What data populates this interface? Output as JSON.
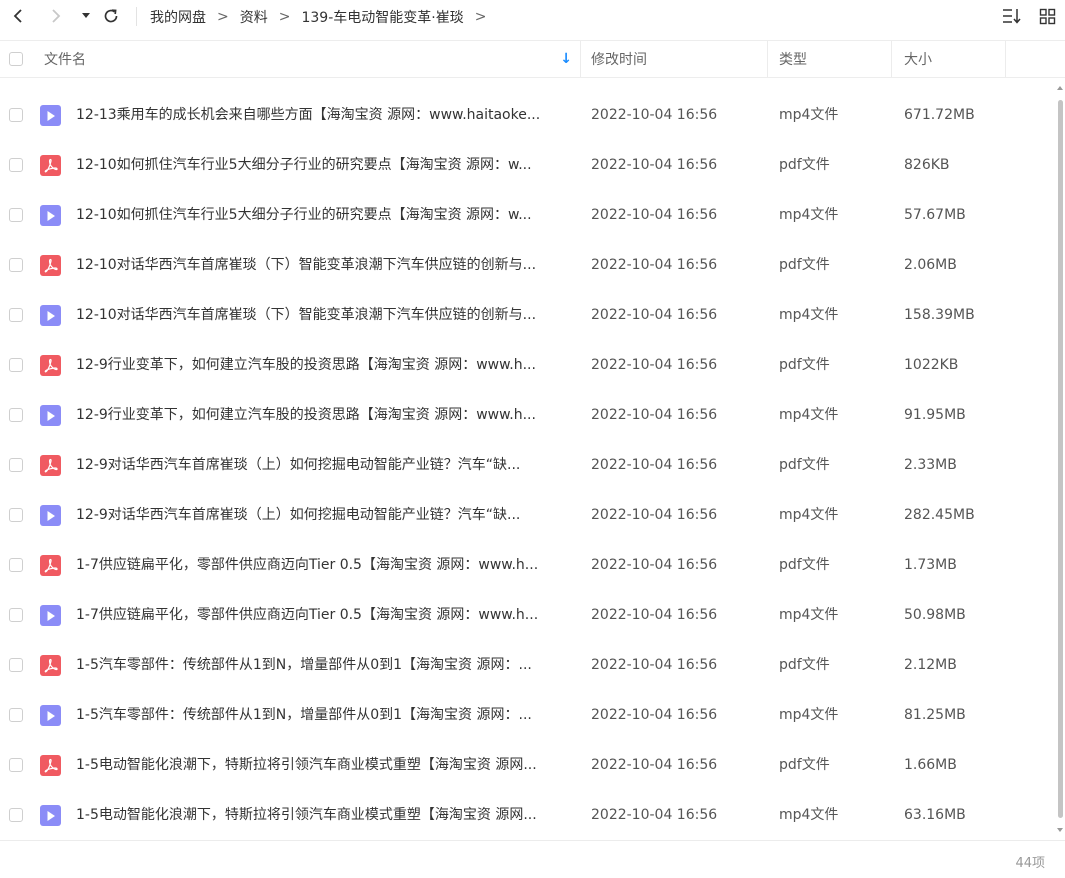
{
  "toolbar": {
    "back_icon": "chevron-left-icon",
    "forward_icon": "chevron-right-icon",
    "history_icon": "caret-down-icon",
    "refresh_icon": "refresh-icon",
    "sort_icon": "sort-list-icon",
    "grid_icon": "grid-view-icon"
  },
  "breadcrumb": {
    "items": [
      "我的网盘",
      "资料",
      "139-车电动智能变革·崔琰"
    ],
    "separator": ">"
  },
  "header": {
    "name": "文件名",
    "modified": "修改时间",
    "type": "类型",
    "size": "大小",
    "sort_arrow": "↓"
  },
  "colors": {
    "mp4_icon": "#8b8cf7",
    "pdf_icon": "#f05a61",
    "sort_arrow": "#1a8cff"
  },
  "files": [
    {
      "icon": "mp4",
      "name": "12-13乘用车的成长机会来自哪些方面【海淘宝资 源网：www.haitaoke...",
      "date": "2022-10-04 16:56",
      "type": "mp4文件",
      "size": "671.72MB"
    },
    {
      "icon": "pdf",
      "name": "12-10如何抓住汽车行业5大细分子行业的研究要点【海淘宝资 源网：w...",
      "date": "2022-10-04 16:56",
      "type": "pdf文件",
      "size": "826KB"
    },
    {
      "icon": "mp4",
      "name": "12-10如何抓住汽车行业5大细分子行业的研究要点【海淘宝资 源网：w...",
      "date": "2022-10-04 16:56",
      "type": "mp4文件",
      "size": "57.67MB"
    },
    {
      "icon": "pdf",
      "name": "12-10对话华西汽车首席崔琰（下）智能变革浪潮下汽车供应链的创新与...",
      "date": "2022-10-04 16:56",
      "type": "pdf文件",
      "size": "2.06MB"
    },
    {
      "icon": "mp4",
      "name": "12-10对话华西汽车首席崔琰（下）智能变革浪潮下汽车供应链的创新与...",
      "date": "2022-10-04 16:56",
      "type": "mp4文件",
      "size": "158.39MB"
    },
    {
      "icon": "pdf",
      "name": "12-9行业变革下，如何建立汽车股的投资思路【海淘宝资 源网：www.h...",
      "date": "2022-10-04 16:56",
      "type": "pdf文件",
      "size": "1022KB"
    },
    {
      "icon": "mp4",
      "name": "12-9行业变革下，如何建立汽车股的投资思路【海淘宝资 源网：www.h...",
      "date": "2022-10-04 16:56",
      "type": "mp4文件",
      "size": "91.95MB"
    },
    {
      "icon": "pdf",
      "name": "12-9对话华西汽车首席崔琰（上）如何挖掘电动智能产业链？汽车“缺...",
      "date": "2022-10-04 16:56",
      "type": "pdf文件",
      "size": "2.33MB"
    },
    {
      "icon": "mp4",
      "name": "12-9对话华西汽车首席崔琰（上）如何挖掘电动智能产业链？汽车“缺...",
      "date": "2022-10-04 16:56",
      "type": "mp4文件",
      "size": "282.45MB"
    },
    {
      "icon": "pdf",
      "name": "1-7供应链扁平化，零部件供应商迈向Tier 0.5【海淘宝资 源网：www.h...",
      "date": "2022-10-04 16:56",
      "type": "pdf文件",
      "size": "1.73MB"
    },
    {
      "icon": "mp4",
      "name": "1-7供应链扁平化，零部件供应商迈向Tier 0.5【海淘宝资 源网：www.h...",
      "date": "2022-10-04 16:56",
      "type": "mp4文件",
      "size": "50.98MB"
    },
    {
      "icon": "pdf",
      "name": "1-5汽车零部件：传统部件从1到N，增量部件从0到1【海淘宝资 源网：...",
      "date": "2022-10-04 16:56",
      "type": "pdf文件",
      "size": "2.12MB"
    },
    {
      "icon": "mp4",
      "name": "1-5汽车零部件：传统部件从1到N，增量部件从0到1【海淘宝资 源网：...",
      "date": "2022-10-04 16:56",
      "type": "mp4文件",
      "size": "81.25MB"
    },
    {
      "icon": "pdf",
      "name": "1-5电动智能化浪潮下，特斯拉将引领汽车商业模式重塑【海淘宝资 源网...",
      "date": "2022-10-04 16:56",
      "type": "pdf文件",
      "size": "1.66MB"
    },
    {
      "icon": "mp4",
      "name": "1-5电动智能化浪潮下，特斯拉将引领汽车商业模式重塑【海淘宝资 源网...",
      "date": "2022-10-04 16:56",
      "type": "mp4文件",
      "size": "63.16MB"
    }
  ],
  "footer": {
    "count": "44项"
  }
}
